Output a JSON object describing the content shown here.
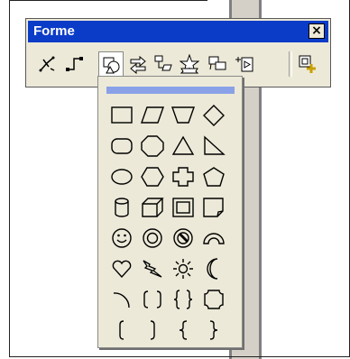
{
  "window": {
    "title": "Forme",
    "close_label": "×"
  },
  "toolbar": {
    "buttons": [
      "connectors-icon",
      "elbow-connector-icon",
      "basic-shapes-icon",
      "block-arrows-icon",
      "flowchart-icon",
      "stars-banners-icon",
      "callouts-icon",
      "action-buttons-icon",
      "more-shapes-icon"
    ],
    "pressed": "basic-shapes-icon"
  },
  "palette": {
    "rows": [
      [
        "rectangle",
        "parallelogram",
        "trapezoid",
        "diamond"
      ],
      [
        "rounded-rectangle",
        "octagon",
        "triangle",
        "right-triangle"
      ],
      [
        "oval",
        "hexagon",
        "cross",
        "pentagon"
      ],
      [
        "can",
        "cube",
        "bevel",
        "folded-corner"
      ],
      [
        "smiley-face",
        "donut",
        "no-symbol",
        "block-arc"
      ],
      [
        "heart",
        "lightning-bolt",
        "sun",
        "moon"
      ],
      [
        "arc",
        "double-bracket",
        "double-brace",
        "plaque"
      ],
      [
        "left-bracket",
        "right-bracket",
        "left-brace",
        "right-brace"
      ]
    ]
  }
}
